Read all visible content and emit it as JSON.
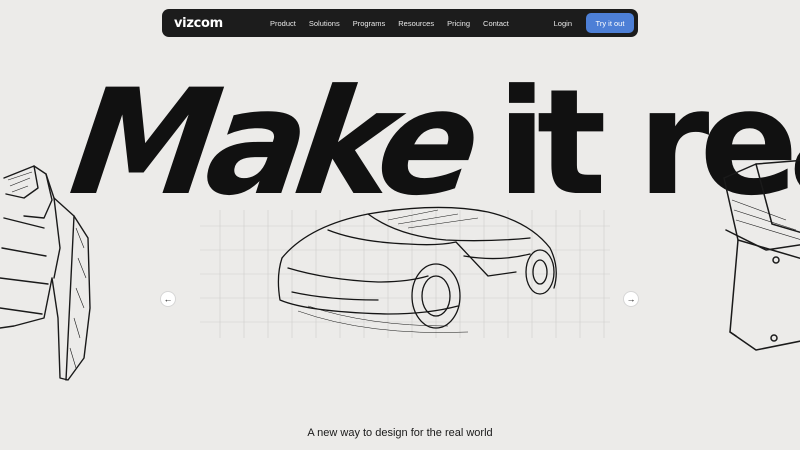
{
  "nav": {
    "logo": "vizcom",
    "links": [
      "Product",
      "Solutions",
      "Programs",
      "Resources",
      "Pricing",
      "Contact"
    ],
    "login": "Login",
    "cta": "Try it out",
    "cta_color": "#4d7fd6",
    "bar_color": "#1c1c1c"
  },
  "hero": {
    "headline_italic": "Make",
    "headline_rest": "it real",
    "tagline": "A new way to design for the real world"
  },
  "carousel": {
    "prev_icon": "arrow-left-icon",
    "next_icon": "arrow-right-icon",
    "prev_glyph": "←",
    "next_glyph": "→"
  },
  "colors": {
    "background": "#ecebe9",
    "ink": "#111111"
  }
}
